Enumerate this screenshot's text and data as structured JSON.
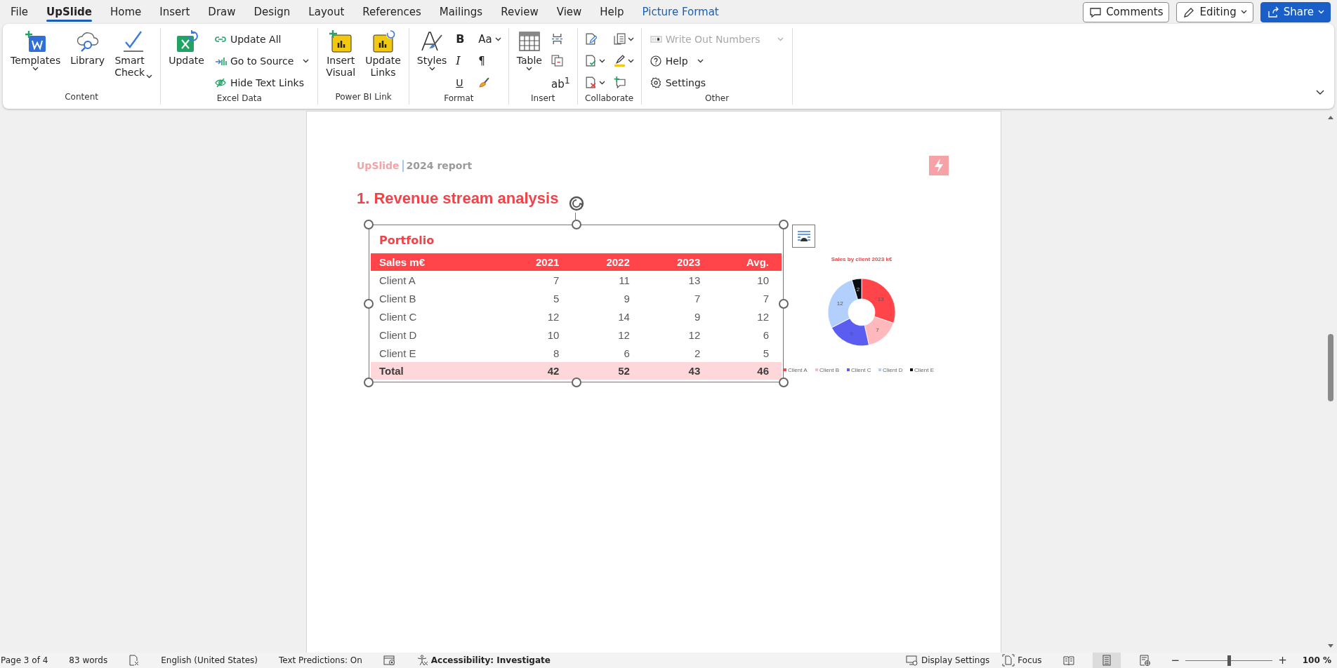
{
  "tabs": [
    {
      "label": "File",
      "selected": false,
      "kind": "normal"
    },
    {
      "label": "UpSlide",
      "selected": true,
      "kind": "normal"
    },
    {
      "label": "Home",
      "selected": false,
      "kind": "normal"
    },
    {
      "label": "Insert",
      "selected": false,
      "kind": "normal"
    },
    {
      "label": "Draw",
      "selected": false,
      "kind": "normal"
    },
    {
      "label": "Design",
      "selected": false,
      "kind": "normal"
    },
    {
      "label": "Layout",
      "selected": false,
      "kind": "normal"
    },
    {
      "label": "References",
      "selected": false,
      "kind": "normal"
    },
    {
      "label": "Mailings",
      "selected": false,
      "kind": "normal"
    },
    {
      "label": "Review",
      "selected": false,
      "kind": "normal"
    },
    {
      "label": "View",
      "selected": false,
      "kind": "normal"
    },
    {
      "label": "Help",
      "selected": false,
      "kind": "normal"
    },
    {
      "label": "Picture Format",
      "selected": false,
      "kind": "contextual"
    }
  ],
  "header_buttons": [
    {
      "label": "Comments",
      "kind": "outline",
      "dropdown": false
    },
    {
      "label": "Editing",
      "kind": "outline",
      "dropdown": true
    },
    {
      "label": "Share",
      "kind": "primary",
      "dropdown": true
    }
  ],
  "ribbon": {
    "groups": [
      {
        "label": "Content",
        "columns": [
          [
            {
              "kind": "large",
              "label": "Templates",
              "dropdown": true
            }
          ],
          [
            {
              "kind": "large",
              "label": "Library",
              "dropdown": false
            }
          ],
          [
            {
              "kind": "split",
              "label": "Smart Check",
              "dropdown": true
            }
          ]
        ]
      },
      {
        "label": "Excel Data",
        "columns": [
          [
            {
              "kind": "large",
              "label": "Update",
              "dropdown": false
            }
          ],
          [
            {
              "kind": "small",
              "label": "Update All",
              "dropdown": false,
              "disabled": false
            },
            {
              "kind": "small",
              "label": "Go to Source",
              "dropdown": true,
              "disabled": false
            },
            {
              "kind": "small",
              "label": "Hide Text Links",
              "dropdown": false,
              "disabled": false
            }
          ]
        ]
      },
      {
        "label": "Power BI Link",
        "columns": [
          [
            {
              "kind": "large",
              "label": "Insert Visual",
              "dropdown": false
            }
          ],
          [
            {
              "kind": "large",
              "label": "Update Links",
              "dropdown": false
            }
          ]
        ]
      },
      {
        "label": "Format",
        "columns": [
          [
            {
              "kind": "large",
              "label": "Styles",
              "dropdown": true
            }
          ],
          [
            {
              "kind": "glyph",
              "label": "B",
              "dropdown": false
            },
            {
              "kind": "glyph",
              "label": "I",
              "dropdown": false
            },
            {
              "kind": "glyph",
              "label": "U",
              "dropdown": false
            }
          ],
          [
            {
              "kind": "glyph",
              "label": "Aa",
              "dropdown": true
            },
            {
              "kind": "glyph",
              "label": "¶",
              "dropdown": false
            },
            {
              "kind": "icon",
              "dropdown": false
            }
          ]
        ]
      },
      {
        "label": "Insert",
        "columns": [
          [
            {
              "kind": "large",
              "label": "Table",
              "dropdown": true
            }
          ],
          [
            {
              "kind": "icon",
              "dropdown": false
            },
            {
              "kind": "icon",
              "dropdown": false
            },
            {
              "kind": "glyph",
              "label": "ab$^{1}$",
              "dropdown": false
            }
          ]
        ]
      },
      {
        "label": "Collaborate",
        "columns": [
          [
            {
              "kind": "icon",
              "dropdown": false
            },
            {
              "kind": "icon",
              "dropdown": true
            },
            {
              "kind": "icon",
              "dropdown": true
            }
          ],
          [
            {
              "kind": "icon",
              "dropdown": true
            },
            {
              "kind": "icon",
              "dropdown": true
            },
            {
              "kind": "icon",
              "dropdown": false
            }
          ]
        ]
      },
      {
        "label": "Other",
        "columns": [
          [
            {
              "kind": "small",
              "label": "Write Out Numbers",
              "dropdown": true,
              "disabled": true
            },
            {
              "kind": "small",
              "label": "Help",
              "dropdown": true,
              "disabled": false
            },
            {
              "kind": "small",
              "label": "Settings",
              "dropdown": false,
              "disabled": false
            }
          ]
        ]
      }
    ]
  },
  "document": {
    "brand": "UpSlide",
    "report": "2024 report",
    "heading": "1. Revenue stream analysis",
    "table": {
      "title": "Portfolio",
      "columns": [
        "Sales m€",
        "2021",
        "2022",
        "2023",
        "Avg."
      ],
      "rows": [
        {
          "kind": "data",
          "cells": [
            "Client A",
            "7",
            "11",
            "13",
            "10"
          ]
        },
        {
          "kind": "data",
          "cells": [
            "Client B",
            "5",
            "9",
            "7",
            "7"
          ]
        },
        {
          "kind": "data",
          "cells": [
            "Client C",
            "12",
            "14",
            "9",
            "12"
          ]
        },
        {
          "kind": "data",
          "cells": [
            "Client D",
            "10",
            "12",
            "12",
            "6"
          ]
        },
        {
          "kind": "data",
          "cells": [
            "Client E",
            "8",
            "6",
            "2",
            "5"
          ]
        },
        {
          "kind": "total",
          "cells": [
            "Total",
            "42",
            "52",
            "43",
            "46"
          ]
        }
      ]
    },
    "chart_data": {
      "type": "donut",
      "title": "Sales by client 2023 k€",
      "categories": [
        "Client A",
        "Client B",
        "Client C",
        "Client D",
        "Client E"
      ],
      "colors": [
        "#ff444a",
        "#ffb9bd",
        "#5b5cf0",
        "#b3d0fc",
        "#0b0b14"
      ],
      "series": [
        {
          "values": [
            13,
            7,
            9,
            12,
            2
          ]
        }
      ],
      "data_labels": true,
      "legend": "bottom"
    }
  },
  "status_bar": {
    "page": "Page 3 of 4",
    "words": "83 words",
    "language": "English (United States)",
    "predictions": "Text Predictions: On",
    "accessibility": "Accessibility: Investigate",
    "display_settings": "Display Settings",
    "focus": "Focus",
    "views": [
      {
        "selected": false
      },
      {
        "selected": true
      },
      {
        "selected": false
      }
    ],
    "zoom_out": "−",
    "zoom_in": "+",
    "zoom": {
      "level": 0.5,
      "reading": "100 %"
    }
  }
}
